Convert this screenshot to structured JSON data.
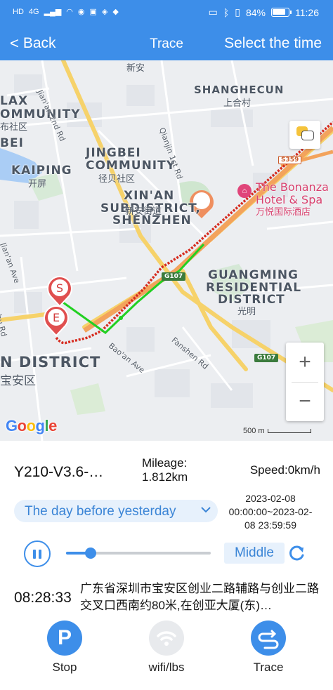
{
  "status_bar": {
    "left_items": [
      "HD",
      "4G",
      "ill",
      "wifi",
      "eye",
      "msg",
      "app",
      "app",
      "app"
    ],
    "battery_text": "84%",
    "time": "11:26"
  },
  "header": {
    "back_label": "Back",
    "title": "Trace",
    "action_label": "Select the time",
    "background_color": "#3d8ee9"
  },
  "map": {
    "areas": [
      {
        "en": "SHANGHECUN",
        "cn": "上合村"
      },
      {
        "en": "LAX",
        "cn": ""
      },
      {
        "en": "OMMUNITY",
        "cn": "布社区"
      },
      {
        "en": "BEI",
        "cn": ""
      },
      {
        "en": "KAIPING",
        "cn": "开屏"
      },
      {
        "en": "JINGBEI",
        "cn": ""
      },
      {
        "en": "COMMUNITY",
        "cn": "径贝社区"
      },
      {
        "en": "XIN'AN",
        "cn": ""
      },
      {
        "en": "SUBDISTRICT,",
        "cn": ""
      },
      {
        "en": "SHENZHEN",
        "cn": "新安街道"
      },
      {
        "en": "GUANGMING",
        "cn": ""
      },
      {
        "en": "RESIDENTIAL",
        "cn": ""
      },
      {
        "en": "DISTRICT",
        "cn": "光明"
      },
      {
        "en": "N DISTRICT",
        "cn": "宝安区"
      }
    ],
    "top_label": "新安",
    "roads": [
      "Jian'an 2nd Rd",
      "Qianjin 1st Rd",
      "Bao'an Ave",
      "Fanshen Rd",
      "Jian'an Ave",
      "ohu Rd"
    ],
    "road_shields": [
      "S359",
      "G107",
      "G107"
    ],
    "poi": {
      "name_line1": "The Bonanza",
      "name_line2": "Hotel & Spa",
      "name_cn": "万悦国际酒店"
    },
    "start_marker": "S",
    "end_marker": "E",
    "zoom_in": "+",
    "zoom_out": "−",
    "google": "Google",
    "scale_text": "500 m",
    "route_color_moving": "#22d022",
    "route_color_other": "#d62b1f"
  },
  "device": {
    "name": "Y210-V3.6-…",
    "mileage_label": "Mileage:",
    "mileage_value": "1.812km",
    "speed_text": "Speed:0km/h"
  },
  "filter": {
    "day_option": "The day before yesterday",
    "date_range": "2023-02-08 00:00:00~2023-02-08 23:59:59"
  },
  "playback": {
    "progress": 0.17,
    "speed_mode": "Middle"
  },
  "track_point": {
    "time": "08:28:33",
    "address": "广东省深圳市宝安区创业二路辅路与创业二路交叉口西南约80米,在创亚大厦(东)…"
  },
  "tabs": [
    {
      "label": "Stop",
      "icon": "parking-icon",
      "color": "#3d8ee9"
    },
    {
      "label": "wifi/lbs",
      "icon": "wifi-icon",
      "color": "#e8eaed"
    },
    {
      "label": "Trace",
      "icon": "trace-icon",
      "color": "#3d8ee9"
    }
  ]
}
